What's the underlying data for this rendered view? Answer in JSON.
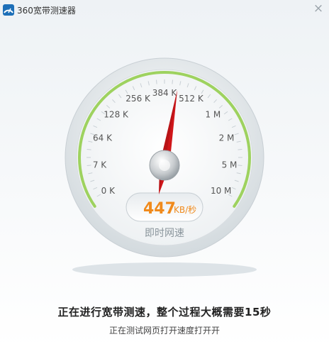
{
  "window": {
    "title": "360宽带测速器",
    "close_label": "×"
  },
  "gauge": {
    "ticks": [
      {
        "label": "0 K"
      },
      {
        "label": "7 K"
      },
      {
        "label": "64 K"
      },
      {
        "label": "128 K"
      },
      {
        "label": "256 K"
      },
      {
        "label": "384 K"
      },
      {
        "label": "512 K"
      },
      {
        "label": "1 M"
      },
      {
        "label": "2 M"
      },
      {
        "label": "5 M"
      },
      {
        "label": "10 M"
      }
    ],
    "speed_value": "447",
    "speed_unit": "KB/秒",
    "caption": "即时网速",
    "colors": {
      "arc": "#9ed25f",
      "needle": "#d0161a",
      "speed": "#f08a1c",
      "ticks": "#555555"
    }
  },
  "status": {
    "main": "正在进行宽带测速，整个过程大概需要15秒",
    "sub": "正在测试网页打开速度打开开"
  }
}
